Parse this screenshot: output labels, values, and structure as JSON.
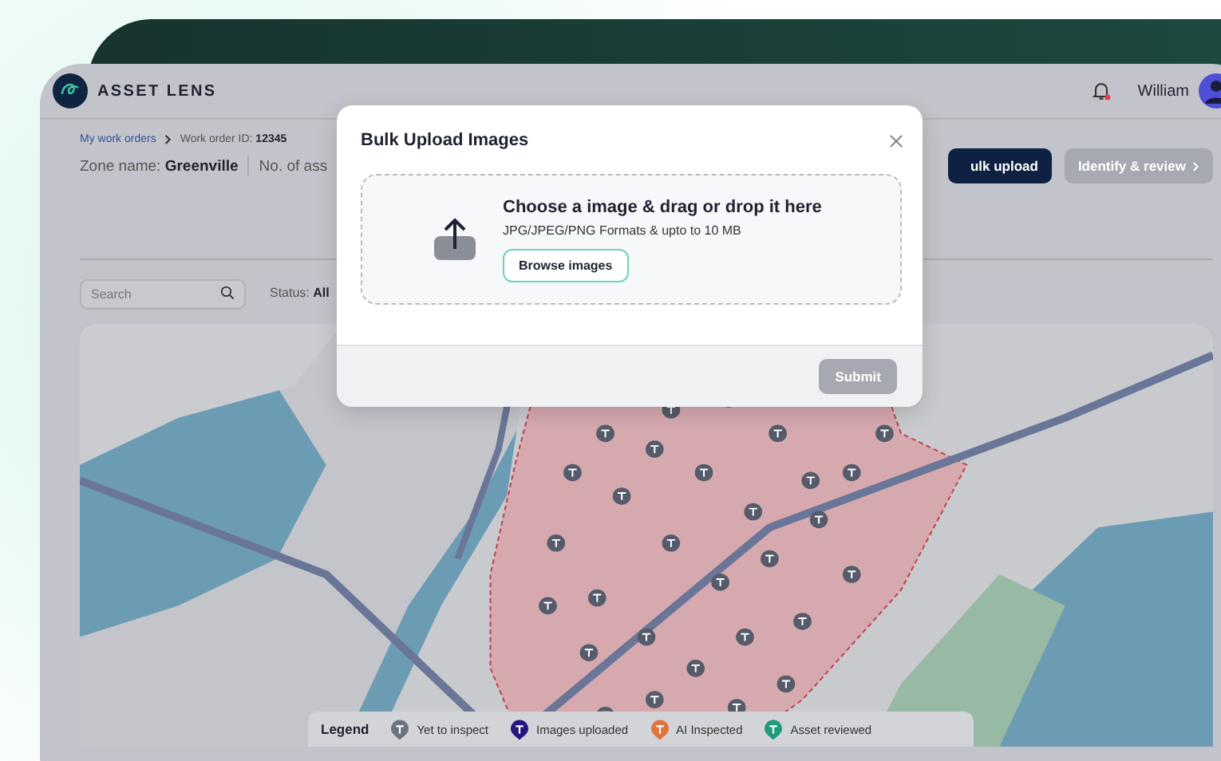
{
  "header": {
    "brand": "ASSET LENS",
    "user_name": "William",
    "notification_unread": true
  },
  "breadcrumb": {
    "link": "My work orders",
    "current_label": "Work order ID:",
    "current_value": "12345"
  },
  "zone": {
    "label": "Zone name:",
    "value": "Greenville",
    "assets_label": "No. of ass"
  },
  "actions": [
    {
      "label": "ulk upload",
      "kind": "primary",
      "disabled": false
    },
    {
      "label": "Identify & review",
      "kind": "next",
      "disabled": true
    }
  ],
  "filters": {
    "search_placeholder": "Search",
    "status_label": "Status:",
    "status_value": "All"
  },
  "legend": {
    "title": "Legend",
    "items": [
      {
        "label": "Yet to inspect",
        "color": "#6b7280"
      },
      {
        "label": "Images uploaded",
        "color": "#2a1580"
      },
      {
        "label": "AI Inspected",
        "color": "#e2733f"
      },
      {
        "label": "Asset reviewed",
        "color": "#1f9a7c"
      }
    ]
  },
  "modal": {
    "title": "Bulk Upload Images",
    "drop_title": "Choose a image & drag or drop it here",
    "drop_hint": "JPG/JPEG/PNG Formats & upto to 10 MB",
    "browse_label": "Browse images",
    "submit_label": "Submit",
    "submit_disabled": true
  }
}
